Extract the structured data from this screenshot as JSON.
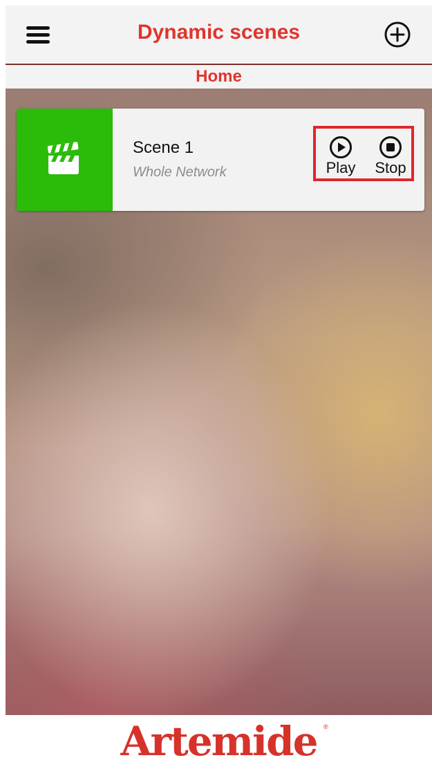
{
  "header": {
    "title": "Dynamic scenes",
    "menu_icon": "hamburger-menu-icon",
    "add_icon": "plus-circle-icon",
    "accent_color": "#e0342e"
  },
  "breadcrumb": {
    "label": "Home"
  },
  "scenes": [
    {
      "name": "Scene 1",
      "scope": "Whole Network",
      "icon": "clapperboard-icon",
      "icon_bg_color": "#2bbb0b",
      "controls": [
        {
          "label": "Play",
          "icon": "play-circle-icon"
        },
        {
          "label": "Stop",
          "icon": "stop-circle-icon"
        }
      ]
    }
  ],
  "footer": {
    "logo_text": "Artemide",
    "registered_mark": "®",
    "logo_color": "#d6322a"
  }
}
